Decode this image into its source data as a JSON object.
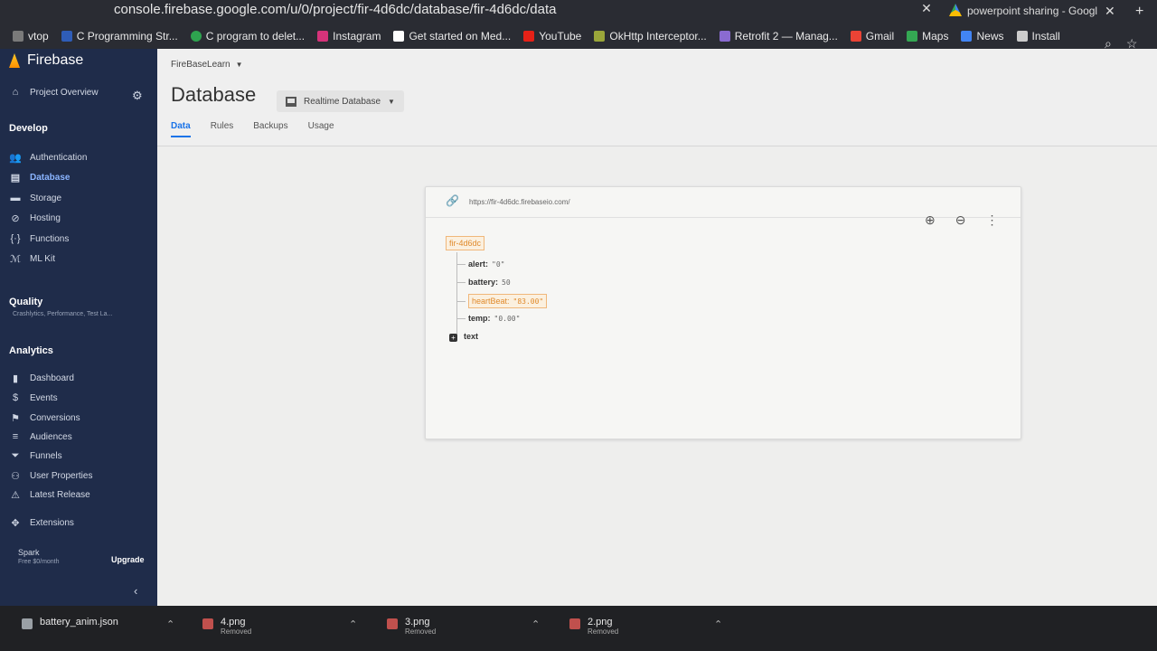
{
  "browser": {
    "url": "console.firebase.google.com/u/0/project/fir-4d6dc/database/fir-4d6dc/data",
    "other_tab_title": "powerpoint sharing - Googl",
    "bookmarks": [
      {
        "label": "vtop",
        "color": "#7a7a7a"
      },
      {
        "label": "C Programming Str...",
        "color": "#2f5db8"
      },
      {
        "label": "C program to delet...",
        "color": "#2ea44f"
      },
      {
        "label": "Instagram",
        "color": "#d6337a"
      },
      {
        "label": "Get started on Med...",
        "color": "#ffffff"
      },
      {
        "label": "YouTube",
        "color": "#e62117"
      },
      {
        "label": "OkHttp Interceptor...",
        "color": "#9aa63a"
      },
      {
        "label": "Retrofit 2 — Manag...",
        "color": "#8a6bd1"
      },
      {
        "label": "Gmail",
        "color": "#ea4335"
      },
      {
        "label": "Maps",
        "color": "#34a853"
      },
      {
        "label": "News",
        "color": "#4285f4"
      },
      {
        "label": "Install",
        "color": "#cccccc"
      }
    ]
  },
  "sidebar": {
    "brand": "Firebase",
    "project_overview": "Project Overview",
    "develop_heading": "Develop",
    "develop_items": [
      "Authentication",
      "Database",
      "Storage",
      "Hosting",
      "Functions",
      "ML Kit"
    ],
    "quality_heading": "Quality",
    "quality_sub": "Crashlytics, Performance, Test La...",
    "analytics_heading": "Analytics",
    "analytics_items": [
      "Dashboard",
      "Events",
      "Conversions",
      "Audiences",
      "Funnels",
      "User Properties",
      "Latest Release"
    ],
    "extensions": "Extensions",
    "plan_name": "Spark",
    "plan_sub": "Free $0/month",
    "upgrade": "Upgrade"
  },
  "main": {
    "project_name": "FireBaseLearn",
    "title": "Database",
    "db_selector": "Realtime Database",
    "tabs": [
      "Data",
      "Rules",
      "Backups",
      "Usage"
    ],
    "db_url": "https://fir-4d6dc.firebaseio.com/",
    "tree": {
      "root": "fir-4d6dc",
      "nodes": [
        {
          "key": "alert:",
          "value": "\"0\""
        },
        {
          "key": "battery:",
          "value": "50"
        },
        {
          "key": "heartBeat:",
          "value": "\"83.00\""
        },
        {
          "key": "temp:",
          "value": "\"0.00\""
        }
      ],
      "collapsed_child": "text"
    }
  },
  "downloads": [
    {
      "name": "battery_anim.json",
      "status": ""
    },
    {
      "name": "4.png",
      "status": "Removed"
    },
    {
      "name": "3.png",
      "status": "Removed"
    },
    {
      "name": "2.png",
      "status": "Removed"
    }
  ]
}
